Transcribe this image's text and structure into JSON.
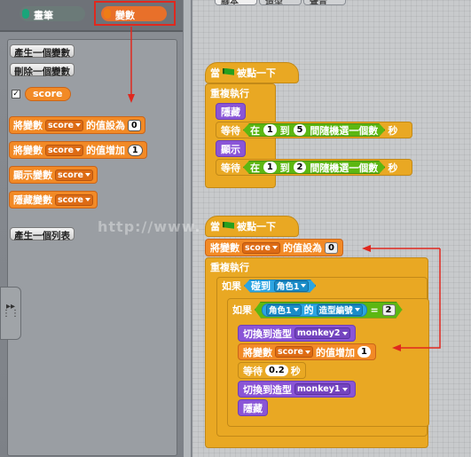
{
  "categories": {
    "pen": "畫筆",
    "variables": "變數"
  },
  "tabs": [
    "腳本",
    "造型",
    "聲音"
  ],
  "palette": {
    "make_var": "產生一個變數",
    "delete_var": "刪除一個變數",
    "var_reporter": "score",
    "var_checked": "✓",
    "set_block": {
      "pre": "將變數",
      "var": "score",
      "mid": "的值設為",
      "val": "0"
    },
    "change_block": {
      "pre": "將變數",
      "var": "score",
      "mid": "的值增加",
      "val": "1"
    },
    "show_block": {
      "pre": "顯示變數",
      "var": "score"
    },
    "hide_block": {
      "pre": "隱藏變數",
      "var": "score"
    },
    "make_list": "產生一個列表"
  },
  "script1": {
    "hat": {
      "pre": "當",
      "post": "被點一下"
    },
    "forever": "重複執行",
    "hide": "隱藏",
    "wait1": {
      "pre": "等待",
      "a": "在",
      "from": "1",
      "to_word": "到",
      "to": "5",
      "post": "間隨機選一個數",
      "unit": "秒"
    },
    "show": "顯示",
    "wait2": {
      "pre": "等待",
      "a": "在",
      "from": "1",
      "to_word": "到",
      "to": "2",
      "post": "間隨機選一個數",
      "unit": "秒"
    }
  },
  "script2": {
    "hat": {
      "pre": "當",
      "post": "被點一下"
    },
    "set": {
      "pre": "將變數",
      "var": "score",
      "mid": "的值設為",
      "val": "0"
    },
    "forever": "重複執行",
    "if1": {
      "pre": "如果",
      "touch": "碰到",
      "sprite": "角色1"
    },
    "if2": {
      "pre": "如果",
      "sprite": "角色1",
      "of": "的",
      "attr": "造型編號",
      "eq": "=",
      "val": "2"
    },
    "costume1": {
      "pre": "切換到造型",
      "name": "monkey2"
    },
    "change": {
      "pre": "將變數",
      "var": "score",
      "mid": "的值增加",
      "val": "1"
    },
    "wait": {
      "pre": "等待",
      "val": "0.2",
      "unit": "秒"
    },
    "costume2": {
      "pre": "切換到造型",
      "name": "monkey1"
    },
    "hide": "隱藏"
  },
  "watermark": "http://www.               e.cn",
  "colors": {
    "control": "#e9a823",
    "looks": "#8a55d7",
    "operators": "#5cb712",
    "sensing": "#2ca5e2",
    "variables": "#f28a26",
    "annotation": "#e0281e"
  },
  "icons": {
    "flag": "green-flag-icon",
    "handle": "panel-handle-icon"
  }
}
